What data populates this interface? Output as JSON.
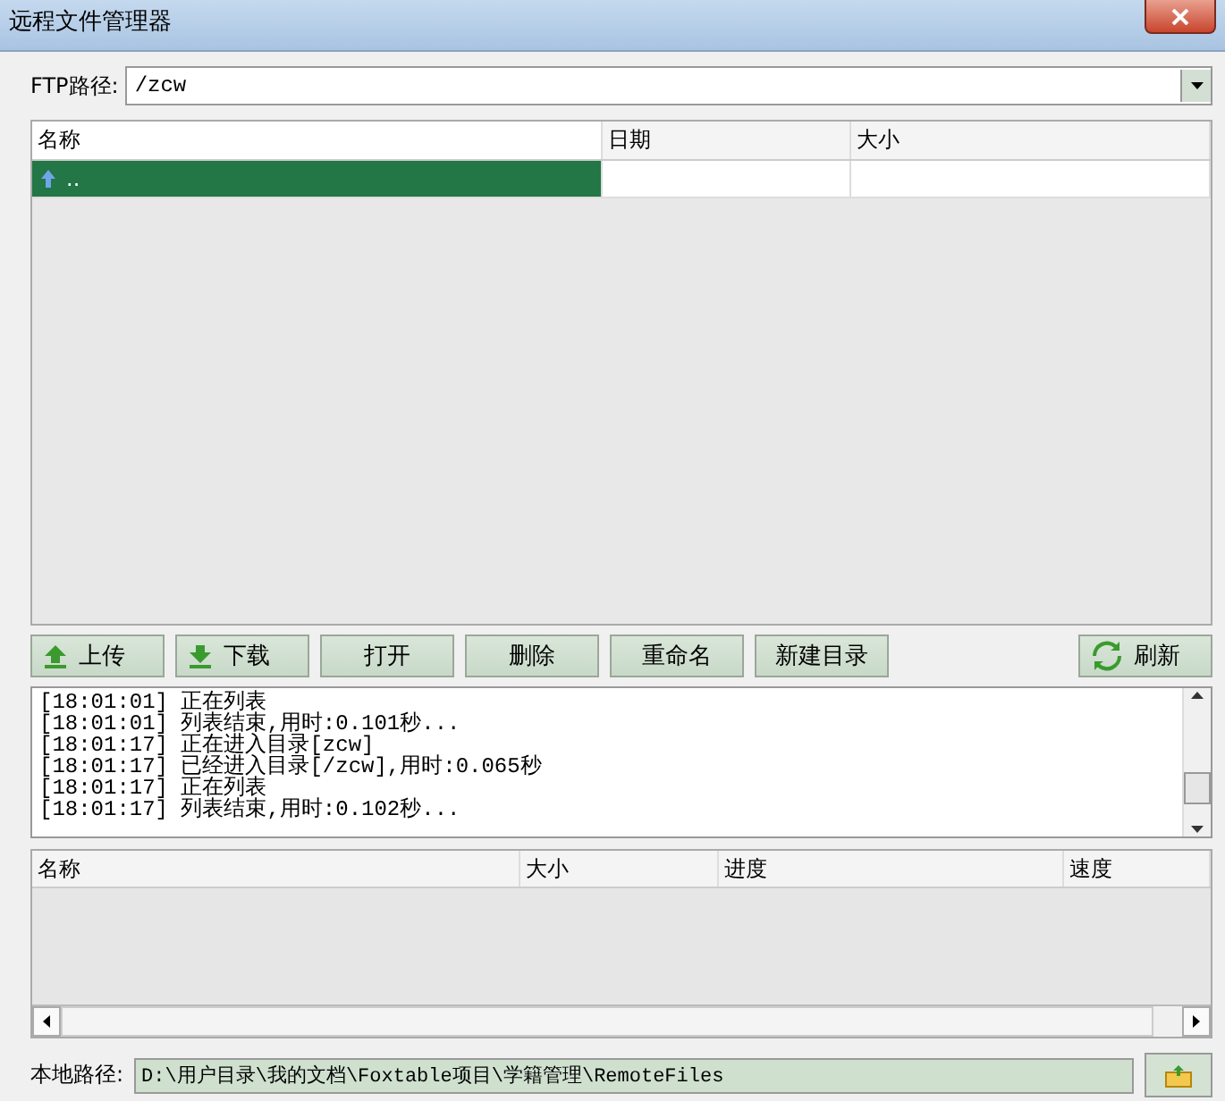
{
  "window": {
    "title": "远程文件管理器"
  },
  "ftp_path": {
    "label": "FTP路径:",
    "value": "/zcw"
  },
  "remote_files": {
    "columns": [
      "名称",
      "日期",
      "大小"
    ],
    "rows": [
      {
        "kind": "parent",
        "name": "..",
        "selected": true
      }
    ]
  },
  "buttons": [
    {
      "label": "上传",
      "kind": "upload"
    },
    {
      "label": "下载",
      "kind": "download"
    },
    {
      "label": "打开",
      "kind": "plain"
    },
    {
      "label": "删除",
      "kind": "plain"
    },
    {
      "label": "重命名",
      "kind": "plain"
    },
    {
      "label": "新建目录",
      "kind": "plain"
    },
    {
      "label": "刷新",
      "kind": "refresh"
    }
  ],
  "log": [
    "[18:01:01] 正在列表",
    "[18:01:01] 列表结束,用时:0.101秒...",
    "[18:01:17] 正在进入目录[zcw]",
    "[18:01:17] 已经进入目录[/zcw],用时:0.065秒",
    "[18:01:17] 正在列表",
    "[18:01:17] 列表结束,用时:0.102秒..."
  ],
  "transfers": {
    "columns": [
      "名称",
      "大小",
      "进度",
      "速度"
    ]
  },
  "local_path": {
    "label": "本地路径:",
    "value": "D:\\用户目录\\我的文档\\Foxtable项目\\学籍管理\\RemoteFiles"
  }
}
